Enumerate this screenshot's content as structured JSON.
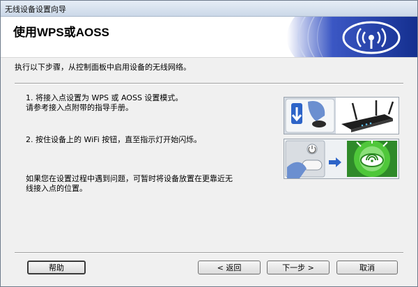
{
  "window": {
    "title": "无线设备设置向导"
  },
  "header": {
    "title": "使用WPS或AOSS"
  },
  "instruction": "执行以下步骤，从控制面板中启用设备的无线网络。",
  "steps": {
    "step1_line1": "1. 将接入点设置为 WPS 或 AOSS 设置模式。",
    "step1_line2": "请参考接入点附带的指导手册。",
    "step2": "2. 按住设备上的 WiFi 按钮，直至指示灯开始闪烁。"
  },
  "help_note": {
    "line1": "如果您在设置过程中遇到问题，可暂时将设备放置在更靠近无",
    "line2": "线接入点的位置。"
  },
  "buttons": {
    "help": "帮助",
    "back": "< 返回",
    "next": "下一步 >",
    "cancel": "取消"
  },
  "colors": {
    "header_logo_blue": "#1a3a9c",
    "wifi_green": "#3dbb2a",
    "titlebar": "#cbd8e8"
  },
  "icons": {
    "logo": "wifi-signal-logo",
    "step1": "router-button-illustration",
    "step2": "wifi-button-illustration"
  }
}
